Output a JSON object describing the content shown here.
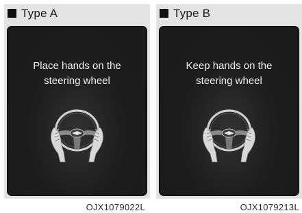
{
  "panels": [
    {
      "type_label": "Type A",
      "message": "Place hands on the\nsteering wheel",
      "figure_code": "OJX1079022L",
      "icon": "hands-on-steering-wheel-icon"
    },
    {
      "type_label": "Type B",
      "message": "Keep hands on the\nsteering wheel",
      "figure_code": "OJX1079213L",
      "icon": "hands-on-steering-wheel-icon"
    }
  ],
  "colors": {
    "panel_bg": "#e3e3e3",
    "screen_bg": "#1b1b1b",
    "screen_text": "#f2f2f2",
    "header_square": "#111111"
  }
}
